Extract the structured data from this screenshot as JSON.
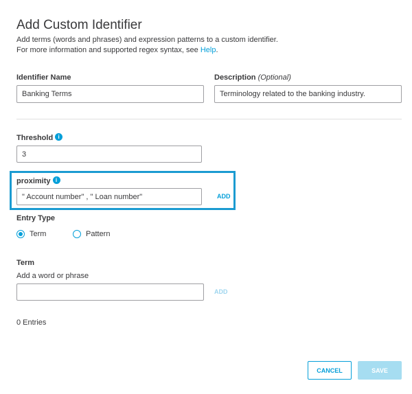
{
  "dialog": {
    "title": "Add Custom Identifier",
    "description_line1": "Add terms (words and phrases) and expression patterns to a custom identifier.",
    "description_line2_prefix": "For more information and supported regex syntax, see ",
    "help_link": "Help",
    "description_line2_suffix": "."
  },
  "identifier_name": {
    "label": "Identifier Name",
    "value": "Banking Terms"
  },
  "description_field": {
    "label": "Description",
    "optional_label": "(Optional)",
    "value": "Terminology related to the banking industry."
  },
  "threshold": {
    "label": "Threshold",
    "info_icon": "info-icon",
    "value": "3"
  },
  "proximity": {
    "label": "proximity",
    "info_icon": "info-icon",
    "value": "\" Account number\" , \" Loan number\"",
    "add_label": "ADD"
  },
  "entry_type": {
    "label": "Entry Type",
    "options": [
      "Term",
      "Pattern"
    ],
    "selected": "Term"
  },
  "term": {
    "label": "Term",
    "hint": "Add a word or phrase",
    "value": "",
    "add_label": "ADD"
  },
  "entries": {
    "count_text": "0 Entries"
  },
  "footer": {
    "cancel_label": "CANCEL",
    "save_label": "SAVE"
  },
  "colors": {
    "accent": "#049fd9",
    "highlight_border": "#1b9bd1",
    "save_disabled": "#a6ddf1"
  }
}
